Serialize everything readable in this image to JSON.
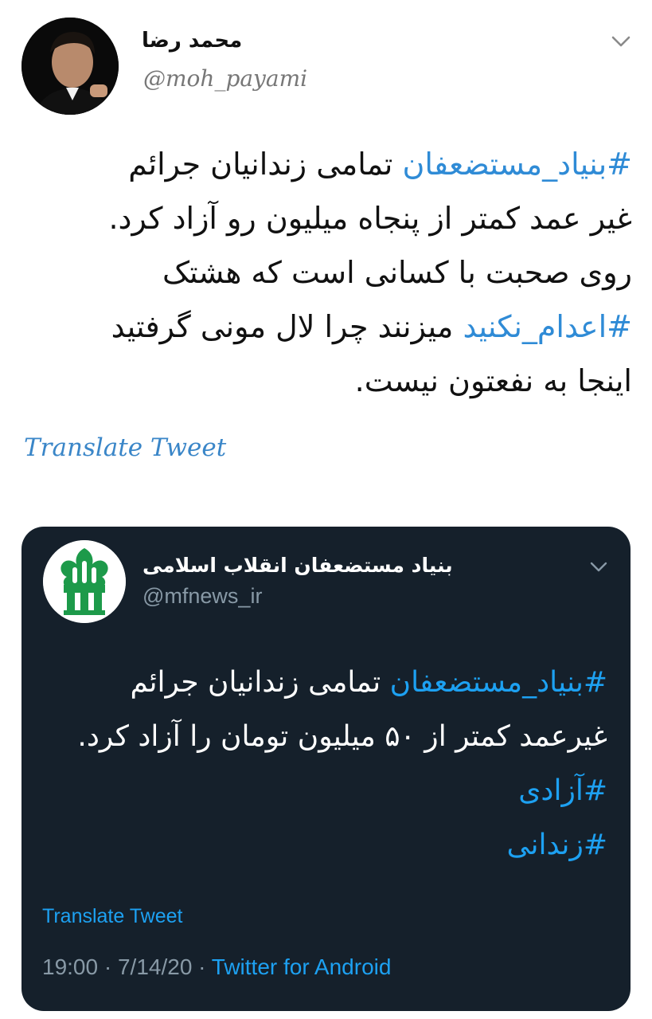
{
  "tweet": {
    "author": {
      "display_name": "محمد رضا",
      "handle": "@moh_payami"
    },
    "text_lines": [
      {
        "hashtag": "#بنیاد_مستضعفان",
        "text": " تمامی زندانیان جرائم"
      },
      {
        "hashtag": "",
        "text": "غیر عمد کمتر از پنجاه میلیون رو آزاد کرد."
      },
      {
        "hashtag": "",
        "text": "روی صحبت با کسانی است که هشتک"
      },
      {
        "hashtag": "#اعدام_نکنید",
        "text": " میزنند چرا لال مونی گرفتید"
      },
      {
        "hashtag": "",
        "text": "اینجا به نفعتون نیست."
      }
    ],
    "translate_label": "Translate Tweet"
  },
  "quoted_tweet": {
    "author": {
      "display_name": "بنیاد مستضعفان انقلاب اسلامی",
      "handle": "@mfnews_ir"
    },
    "text_lines": [
      {
        "hashtag": "#بنیاد_مستضعفان",
        "text": " تمامی زندانیان جرائم"
      },
      {
        "hashtag": "",
        "text": "غیرعمد کمتر از ۵۰ میلیون تومان را آزاد کرد."
      },
      {
        "hashtag": "#آزادی",
        "text": ""
      },
      {
        "hashtag": "#زندانی",
        "text": ""
      }
    ],
    "translate_label": "Translate Tweet",
    "time": "19:00",
    "separator": " · ",
    "date": "7/14/20",
    "source": "Twitter for Android"
  },
  "icons": {
    "more_options": "chevron-down-icon",
    "logo": "mostazafan-foundation-logo"
  },
  "colors": {
    "hashtag_light": "#2f8bd6",
    "hashtag_dark": "#1da1f2",
    "embed_background": "#15202b",
    "secondary_text": "#8899a6",
    "logo_green": "#1d9a4a"
  }
}
